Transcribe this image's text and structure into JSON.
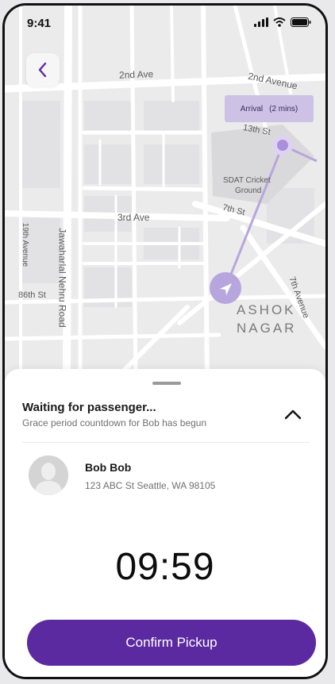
{
  "status_bar": {
    "time": "9:41",
    "icons": [
      "signal-icon",
      "wifi-icon",
      "battery-icon"
    ]
  },
  "map": {
    "back_icon": "chevron-left-icon",
    "arrival_label": "Arrival",
    "arrival_eta": "(2 mins)",
    "streets": {
      "second_ave_left": "2nd Ave",
      "second_avenue_right": "2nd Avenue",
      "thirteenth_st": "13th St",
      "sdat_line1": "SDAT Cricket",
      "sdat_line2": "Ground",
      "seventh_st": "7th St",
      "third_ave": "3rd Ave",
      "nineteenth_avenue": "19th Avenue",
      "jawaharlal": "Jawaharlal Nehru Road",
      "eightysixth_st": "86th St",
      "seventh_avenue": "7th Avenue",
      "ashok": "ASHOK",
      "nagar": "NAGAR"
    },
    "colors": {
      "route": "#b7a6de",
      "marker": "#b7a6de",
      "destination": "#a98fdc"
    }
  },
  "sheet": {
    "title": "Waiting for passenger...",
    "subtitle": "Grace period countdown for Bob has begun",
    "collapse_icon": "chevron-up-icon",
    "passenger": {
      "name": "Bob Bob",
      "address": "123 ABC St Seattle, WA 98105",
      "avatar_icon": "avatar-placeholder-icon"
    },
    "countdown": "09:59",
    "confirm_label": "Confirm Pickup",
    "accent_color": "#5b2aa0"
  }
}
